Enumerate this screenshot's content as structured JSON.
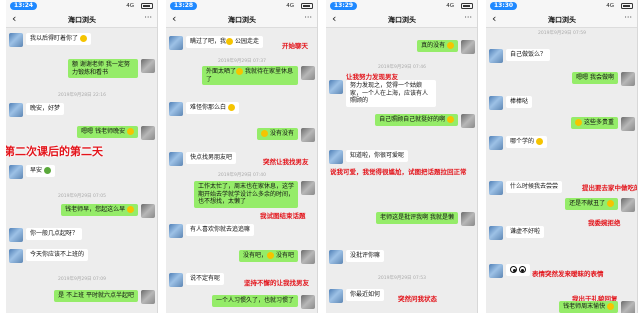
{
  "screens": [
    {
      "time": "13:24",
      "network": "4G",
      "title": "海口浏头",
      "messages": [
        {
          "side": "l",
          "text": "我以后得盯着你了",
          "sticker": "smile"
        },
        {
          "side": "r",
          "text": "额 谢谢老师 我一定努力锻炼和看书"
        },
        {
          "time": "2019年9月28日 22:16"
        },
        {
          "side": "l",
          "text": "晚安，好梦"
        },
        {
          "side": "r",
          "text": "嗯嗯 钱老师晚安",
          "sticker": "smile"
        },
        {
          "side": "l",
          "text": "早安",
          "sticker": "plant"
        },
        {
          "time": "2019年9月29日 07:05"
        },
        {
          "side": "r",
          "text": "钱老师早，您起这么早",
          "sticker": "smile"
        },
        {
          "side": "l",
          "text": "你一般几点起呀？"
        },
        {
          "side": "l",
          "text": "今天你应该不上班的"
        },
        {
          "time": "2019年9月29日 07:09"
        },
        {
          "side": "r",
          "text": "是 不上班 平时就六点半起吧"
        }
      ],
      "notes": [
        {
          "text": "第二次课后的第二天",
          "size": "big"
        }
      ]
    },
    {
      "time": "13:28",
      "network": "4G",
      "title": "海口浏头",
      "messages": [
        {
          "side": "l",
          "text": "瞒过了吧，我",
          "sticker": "smile",
          "extra": "公园走走"
        },
        {
          "time": "2019年9月29日 07:37"
        },
        {
          "side": "r",
          "text": "外面太晒了",
          "sticker": "smile",
          "extra": "我就待在家里休息了"
        },
        {
          "side": "l",
          "text": "难怪你那么白",
          "sticker": "smile"
        },
        {
          "side": "r",
          "text": "没有没有",
          "sticker": "smile"
        },
        {
          "side": "l",
          "text": "快点找男朋友吧"
        },
        {
          "time": "2019年9月29日 07:40"
        },
        {
          "side": "r",
          "text": "工作太忙了，周末也在家休息，这学期开始去学就学设计么多余的时间，也不想找，太懒了"
        },
        {
          "side": "l",
          "text": "有人喜欢你就去追追嘛"
        },
        {
          "side": "r",
          "text": "没有吧，",
          "sticker": "smile",
          "extra": "没有吧"
        },
        {
          "side": "l",
          "text": "说不定有呢"
        },
        {
          "side": "r",
          "text": "一个人习惯久了，也就习惯了"
        }
      ],
      "notes": [
        {
          "text": "开始聊天",
          "size": "s"
        },
        {
          "text": "突然让我找男友",
          "size": "s"
        },
        {
          "text": "我试图结束话题",
          "size": "s"
        },
        {
          "text": "坚持不懈的让我找男友",
          "size": "s"
        }
      ]
    },
    {
      "time": "13:29",
      "network": "4G",
      "title": "海口浏头",
      "messages": [
        {
          "side": "r",
          "text": "真的没有",
          "sticker": "smile"
        },
        {
          "time": "2019年9月29日 07:46"
        },
        {
          "side": "l",
          "text": "努力发现之，觉得一个姑娘家，一个人在上海，应该有人照顾的"
        },
        {
          "side": "r",
          "text": "自己照顾自己就挺好的啊",
          "sticker": "smile"
        },
        {
          "side": "l",
          "text": "知道啦，你很可爱呢"
        },
        {
          "side": "r",
          "text": "老师这是批评我啊 我就是懒"
        },
        {
          "side": "l",
          "text": "没批评你嘛"
        },
        {
          "time": "2019年9月29日 07:53"
        },
        {
          "side": "l",
          "text": "你最近如何"
        }
      ],
      "notes": [
        {
          "text": "让我努力发现男友",
          "size": "s"
        },
        {
          "text": "说我可爱，我觉得很尴尬，试图把话题拉回正常",
          "size": "s"
        },
        {
          "text": "突然问我状态",
          "size": "s"
        }
      ]
    },
    {
      "time": "13:30",
      "network": "4G",
      "title": "海口浏头",
      "messages": [
        {
          "time": "2019年9月29日 07:59"
        },
        {
          "side": "l",
          "text": "自己做饭么？"
        },
        {
          "side": "r",
          "text": "嗯嗯 我会做啊"
        },
        {
          "side": "l",
          "text": "棒棒哒"
        },
        {
          "side": "r",
          "text": "这些多贵重",
          "sticker": "smile"
        },
        {
          "side": "l",
          "text": "哪个学的",
          "sticker": "smile"
        },
        {
          "side": "l",
          "text": "什么时候我去尝尝"
        },
        {
          "side": "r",
          "text": "还是不献丑了",
          "sticker": "smile"
        },
        {
          "side": "l",
          "text": "谦虚不好啦"
        },
        {
          "side": "l",
          "sticker": "eyes"
        },
        {
          "side": "r",
          "text": "钱老师周末愉快",
          "sticker": "smile"
        }
      ],
      "notes": [
        {
          "text": "提出要去家中做吃的",
          "size": "s"
        },
        {
          "text": "我委婉拒绝",
          "size": "s"
        },
        {
          "text": "表情突然发来暧昧的表情",
          "size": "s"
        },
        {
          "text": "我出于礼貌回复",
          "size": "s"
        }
      ]
    }
  ]
}
